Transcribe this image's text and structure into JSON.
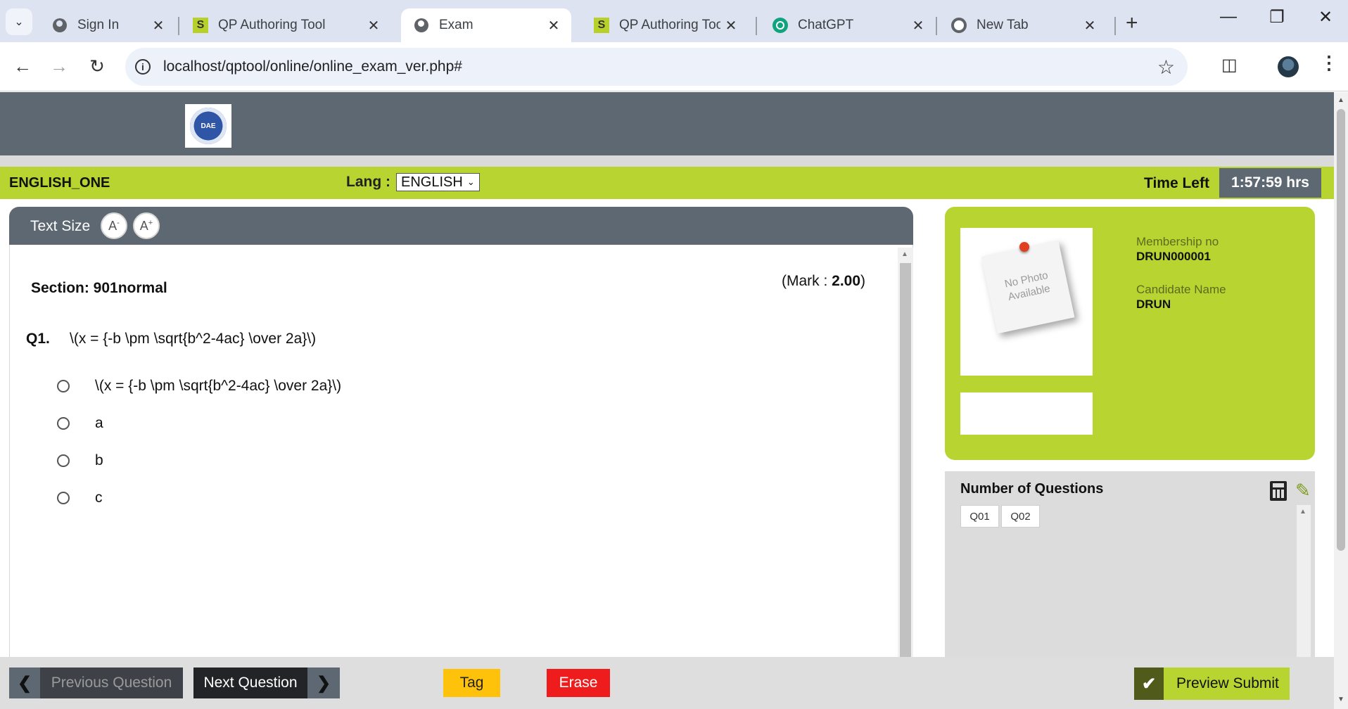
{
  "browser": {
    "tabs": [
      {
        "title": "Sign In",
        "icon": "globe-icon",
        "active": false
      },
      {
        "title": "QP Authoring Tool",
        "icon": "s-app-icon",
        "active": false
      },
      {
        "title": "Exam",
        "icon": "globe-icon",
        "active": true
      },
      {
        "title": "QP Authoring Tool",
        "icon": "s-app-icon",
        "active": false
      },
      {
        "title": "ChatGPT",
        "icon": "chatgpt-icon",
        "active": false
      },
      {
        "title": "New Tab",
        "icon": "chrome-icon",
        "active": false
      }
    ],
    "url": "localhost/qptool/online/online_exam_ver.php#"
  },
  "header": {
    "logo_text": "DAE"
  },
  "exam_bar": {
    "exam_name": "ENGLISH_ONE",
    "lang_label": "Lang :",
    "lang_value": "ENGLISH",
    "time_label": "Time Left",
    "time_value": "1:57:59 hrs"
  },
  "question_panel": {
    "text_size_label": "Text Size",
    "decrease_label": "A",
    "decrease_symbol": "-",
    "increase_label": "A",
    "increase_symbol": "+",
    "section": "Section: 901normal",
    "mark_prefix": "(Mark : ",
    "mark_value": "2.00",
    "mark_suffix": ")",
    "question_number": "Q1.",
    "question_text": "\\(x = {-b \\pm \\sqrt{b^2-4ac} \\over 2a}\\)",
    "options": [
      "\\(x = {-b \\pm \\sqrt{b^2-4ac} \\over 2a}\\)",
      "a",
      "b",
      "c"
    ]
  },
  "candidate": {
    "photo_text": "No Photo Available",
    "membership_label": "Membership no",
    "membership_value": "DRUN000001",
    "name_label": "Candidate Name",
    "name_value": "DRUN"
  },
  "palette": {
    "title": "Number of Questions",
    "questions": [
      "Q01",
      "Q02"
    ]
  },
  "footer": {
    "previous_label": "Previous Question",
    "next_label": "Next Question",
    "tag_label": "Tag",
    "erase_label": "Erase",
    "preview_label": "Preview Submit"
  },
  "colors": {
    "accent_green": "#b8d430",
    "header_gray": "#5e6872",
    "tag_yellow": "#ffc20a",
    "erase_red": "#ee1c1c"
  }
}
